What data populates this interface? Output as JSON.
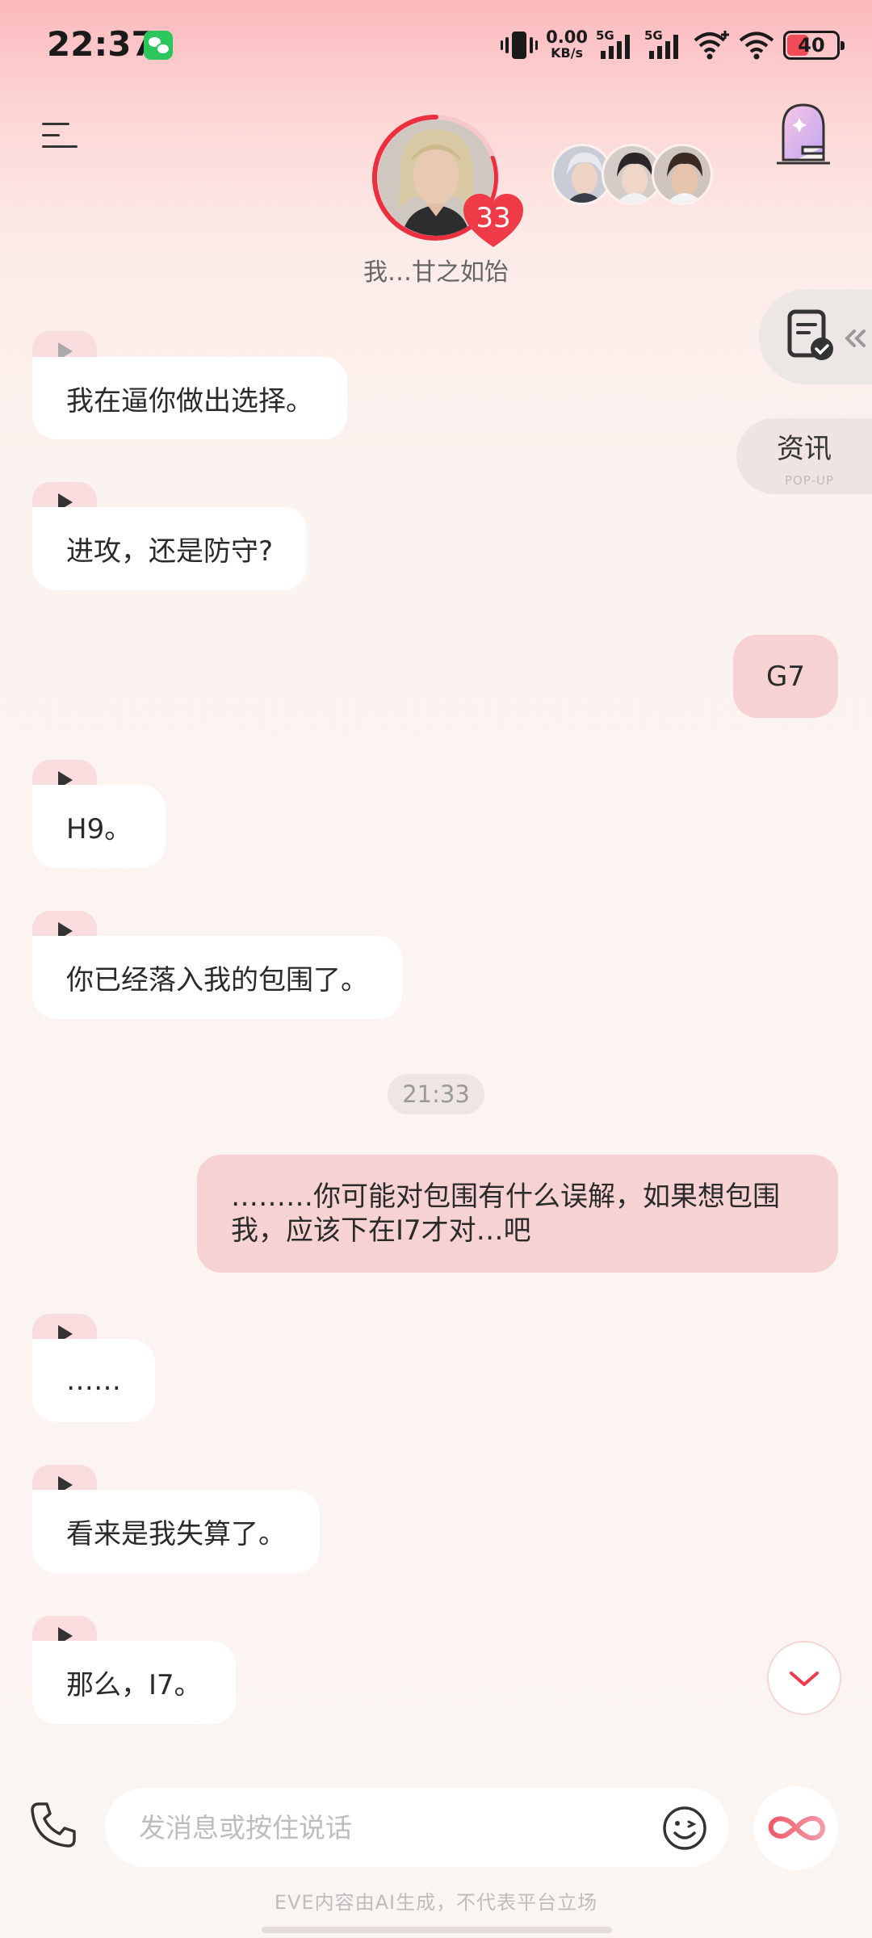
{
  "status_bar": {
    "time": "22:37",
    "net_speed_value": "0.00",
    "net_speed_unit": "KB/s",
    "sim1_label": "5G",
    "sim2_label": "5G",
    "battery": "40"
  },
  "header": {
    "character_name": "我…甘之如饴",
    "level": "33"
  },
  "side_tools": {
    "news_label": "资讯",
    "news_sub": "POP-UP"
  },
  "messages": [
    {
      "from": "character",
      "text": "我在逼你做出选择。"
    },
    {
      "from": "character",
      "text": "进攻，还是防守?"
    },
    {
      "from": "user",
      "text": "G7"
    },
    {
      "from": "character",
      "text": "H9。"
    },
    {
      "from": "character",
      "text": "你已经落入我的包围了。"
    },
    {
      "from": "system",
      "text": "21:33"
    },
    {
      "from": "user",
      "text": "………你可能对包围有什么误解，如果想包围我，应该下在I7才对…吧"
    },
    {
      "from": "character",
      "text": "……"
    },
    {
      "from": "character",
      "text": "看来是我失算了。"
    },
    {
      "from": "character",
      "text": "那么，I7。"
    }
  ],
  "composer": {
    "placeholder": "发消息或按住说话"
  },
  "footer": {
    "disclaimer": "EVE内容由AI生成，不代表平台立场"
  },
  "colors": {
    "accent": "#f0303f",
    "user_bubble": "#f6d3d2",
    "play_tab": "#f9dcdd"
  },
  "icons": [
    "menu-icon",
    "heart-icon",
    "door-icon",
    "document-check-icon",
    "play-icon",
    "chevron-down-icon",
    "phone-icon",
    "emoji-icon",
    "infinity-icon"
  ]
}
